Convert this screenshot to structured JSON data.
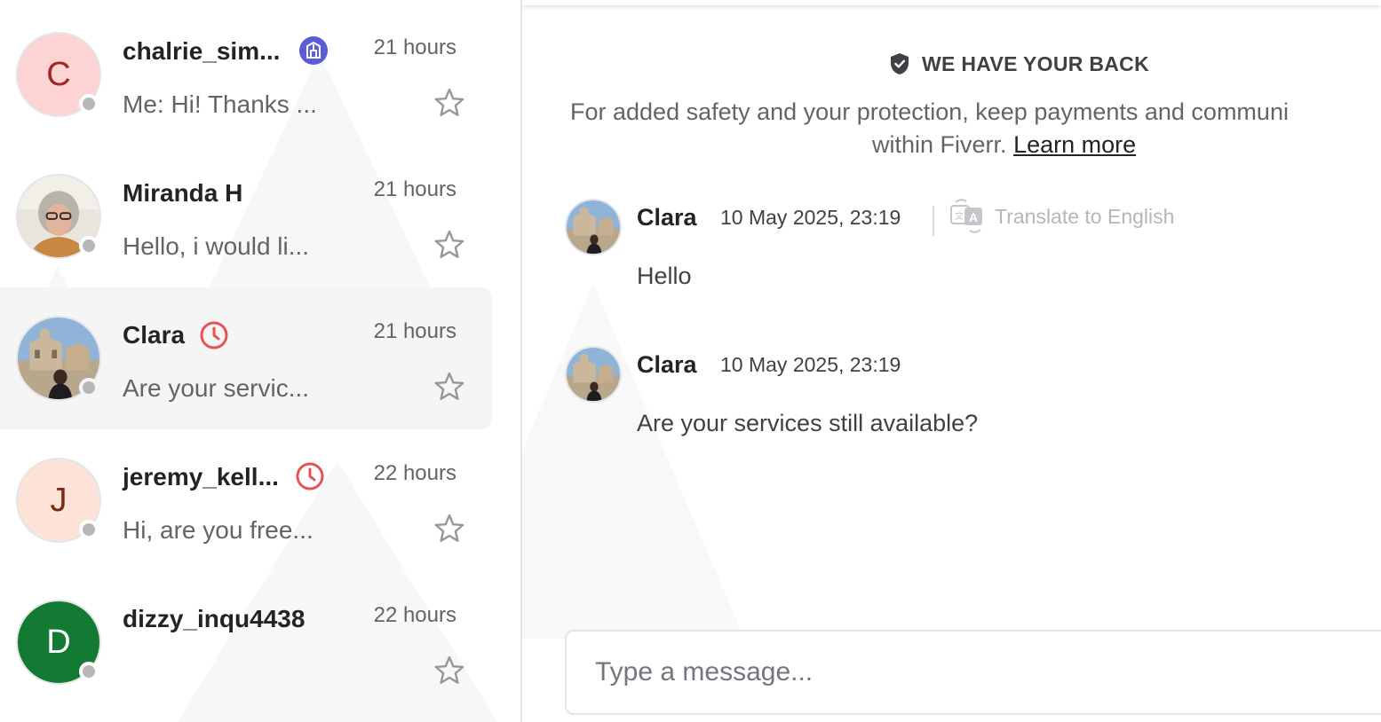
{
  "conversations": [
    {
      "name": "chalrie_sim...",
      "time": "21 hours",
      "preview": "Me: Hi! Thanks ...",
      "avatar_letter": "C",
      "avatar_bg": "#fdd3d3",
      "avatar_fg": "#a3262a",
      "badge_icon": "business-badge-icon",
      "badge_color": "#5a5ed6",
      "starred": false,
      "active": false
    },
    {
      "name": "Miranda H",
      "time": "21 hours",
      "preview": "Hello, i would li...",
      "avatar_letter": "",
      "avatar_icon": "user-photo",
      "starred": false,
      "active": false
    },
    {
      "name": "Clara",
      "time": "21 hours",
      "preview": "Are your servic...",
      "avatar_letter": "",
      "avatar_icon": "user-photo",
      "badge_icon": "clock-icon",
      "badge_color": "#e85254",
      "starred": false,
      "active": true
    },
    {
      "name": "jeremy_kell...",
      "time": "22 hours",
      "preview": "Hi, are you free...",
      "avatar_letter": "J",
      "avatar_bg": "#fde2d8",
      "avatar_fg": "#7a2a14",
      "badge_icon": "clock-icon",
      "badge_color": "#e85254",
      "starred": false,
      "active": false
    },
    {
      "name": "dizzy_inqu4438",
      "time": "22 hours",
      "preview": "",
      "avatar_letter": "D",
      "avatar_bg": "#137a33",
      "avatar_fg": "#ffffff",
      "starred": false,
      "active": false
    }
  ],
  "chat": {
    "safety_title": "WE HAVE YOUR BACK",
    "safety_text_line1": "For added safety and your protection, keep payments and communi",
    "safety_text_line2": "within Fiverr.",
    "learn_more": "Learn more",
    "translate_label": "Translate to English",
    "messages": [
      {
        "sender": "Clara",
        "timestamp": "10 May 2025, 23:19",
        "text": "Hello"
      },
      {
        "sender": "Clara",
        "timestamp": "10 May 2025, 23:19",
        "text": "Are your services still available?"
      }
    ],
    "composer_placeholder": "Type a message..."
  },
  "colors": {
    "presence_offline": "#b5b6ba",
    "active_row_bg": "#f5f5f5",
    "text_primary": "#222325",
    "text_secondary": "#62646a"
  }
}
